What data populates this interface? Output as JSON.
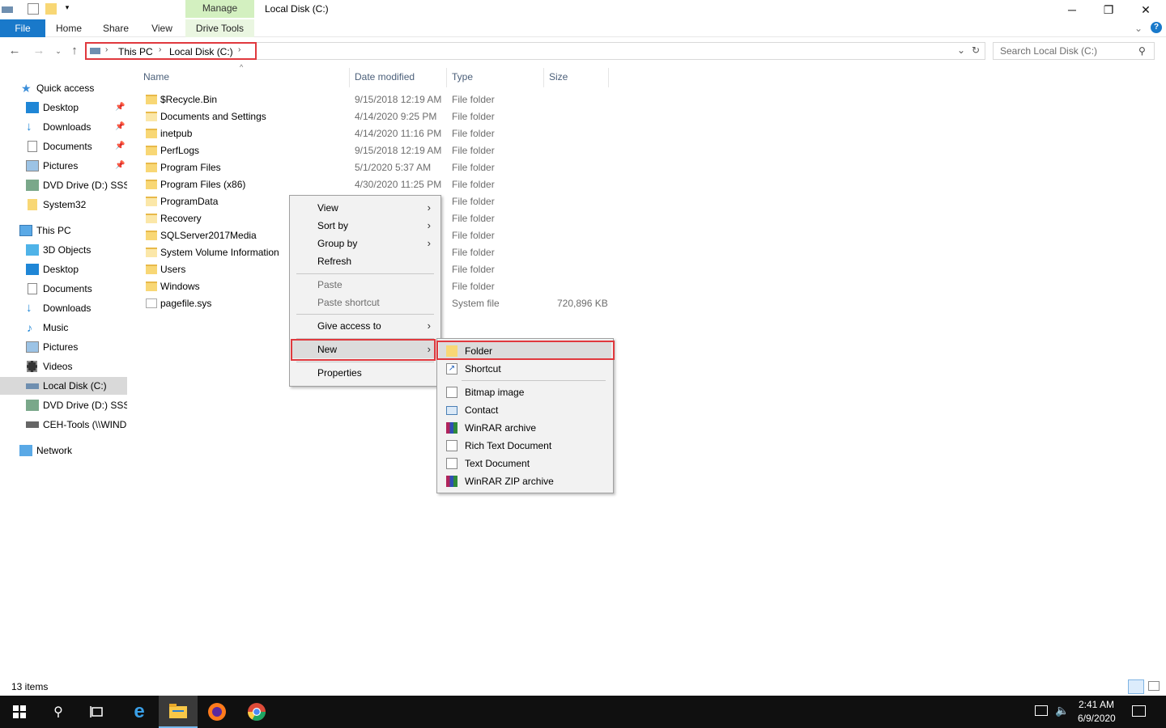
{
  "window": {
    "title": "Local Disk (C:)",
    "context_tab_group": "Manage"
  },
  "ribbon": {
    "tabs": [
      "File",
      "Home",
      "Share",
      "View",
      "Drive Tools"
    ]
  },
  "address": {
    "crumbs": [
      "This PC",
      "Local Disk (C:)"
    ],
    "search_placeholder": "Search Local Disk (C:)"
  },
  "nav_pane": {
    "quick_access": "Quick access",
    "quick_items": [
      "Desktop",
      "Downloads",
      "Documents",
      "Pictures",
      "DVD Drive (D:) SSS_X",
      "System32"
    ],
    "this_pc": "This PC",
    "pc_items": [
      "3D Objects",
      "Desktop",
      "Documents",
      "Downloads",
      "Music",
      "Pictures",
      "Videos",
      "Local Disk (C:)",
      "DVD Drive (D:) SSS_X",
      "CEH-Tools (\\\\WIND"
    ],
    "network": "Network"
  },
  "columns": [
    "Name",
    "Date modified",
    "Type",
    "Size"
  ],
  "files": [
    {
      "name": "$Recycle.Bin",
      "date": "9/15/2018 12:19 AM",
      "type": "File folder",
      "size": ""
    },
    {
      "name": "Documents and Settings",
      "date": "4/14/2020 9:25 PM",
      "type": "File folder",
      "size": ""
    },
    {
      "name": "inetpub",
      "date": "4/14/2020 11:16 PM",
      "type": "File folder",
      "size": ""
    },
    {
      "name": "PerfLogs",
      "date": "9/15/2018 12:19 AM",
      "type": "File folder",
      "size": ""
    },
    {
      "name": "Program Files",
      "date": "5/1/2020 5:37 AM",
      "type": "File folder",
      "size": ""
    },
    {
      "name": "Program Files (x86)",
      "date": "4/30/2020 11:25 PM",
      "type": "File folder",
      "size": ""
    },
    {
      "name": "ProgramData",
      "date": "",
      "type": "File folder",
      "size": ""
    },
    {
      "name": "Recovery",
      "date": "",
      "type": "File folder",
      "size": ""
    },
    {
      "name": "SQLServer2017Media",
      "date": "",
      "type": "File folder",
      "size": ""
    },
    {
      "name": "System Volume Information",
      "date": "",
      "type": "File folder",
      "size": ""
    },
    {
      "name": "Users",
      "date": "",
      "type": "File folder",
      "size": ""
    },
    {
      "name": "Windows",
      "date": "",
      "type": "File folder",
      "size": ""
    },
    {
      "name": "pagefile.sys",
      "date": "",
      "type": "System file",
      "size": "720,896 KB"
    }
  ],
  "context_menu": {
    "view": "View",
    "sort_by": "Sort by",
    "group_by": "Group by",
    "refresh": "Refresh",
    "paste": "Paste",
    "paste_shortcut": "Paste shortcut",
    "give_access": "Give access to",
    "new": "New",
    "properties": "Properties"
  },
  "new_submenu": {
    "folder": "Folder",
    "shortcut": "Shortcut",
    "bitmap": "Bitmap image",
    "contact": "Contact",
    "winrar": "WinRAR archive",
    "rtf": "Rich Text Document",
    "text": "Text Document",
    "winrar_zip": "WinRAR ZIP archive"
  },
  "status": {
    "item_count": "13 items"
  },
  "taskbar": {
    "time": "2:41 AM",
    "date": "6/9/2020"
  },
  "colors": {
    "file_tab": "#1979ca",
    "highlight_box": "#e0393e",
    "taskbar": "#101010"
  }
}
